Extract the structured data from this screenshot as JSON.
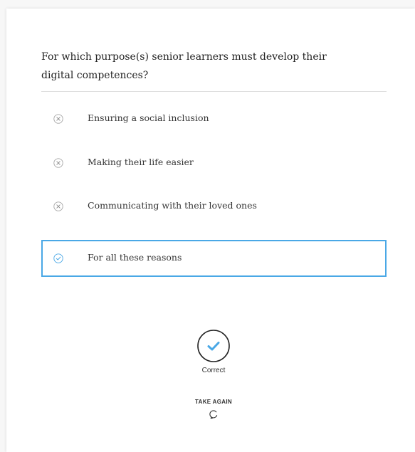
{
  "quiz": {
    "question": "For which purpose(s) senior learners must develop their digital competences?",
    "options": [
      {
        "label": "Ensuring a social inclusion",
        "icon": "x-circle-icon",
        "selected": false
      },
      {
        "label": "Making their life easier",
        "icon": "x-circle-icon",
        "selected": false
      },
      {
        "label": "Communicating with their loved ones",
        "icon": "x-circle-icon",
        "selected": false
      },
      {
        "label": "For all these reasons",
        "icon": "check-circle-icon",
        "selected": true
      }
    ],
    "result": {
      "label": "Correct",
      "icon": "check-circle-icon"
    },
    "take_again": {
      "label": "TAKE AGAIN",
      "icon": "refresh-icon"
    }
  },
  "colors": {
    "accent": "#4aa8e6",
    "text": "#333333",
    "divider": "#dddddd",
    "icon_gray": "#999999"
  }
}
